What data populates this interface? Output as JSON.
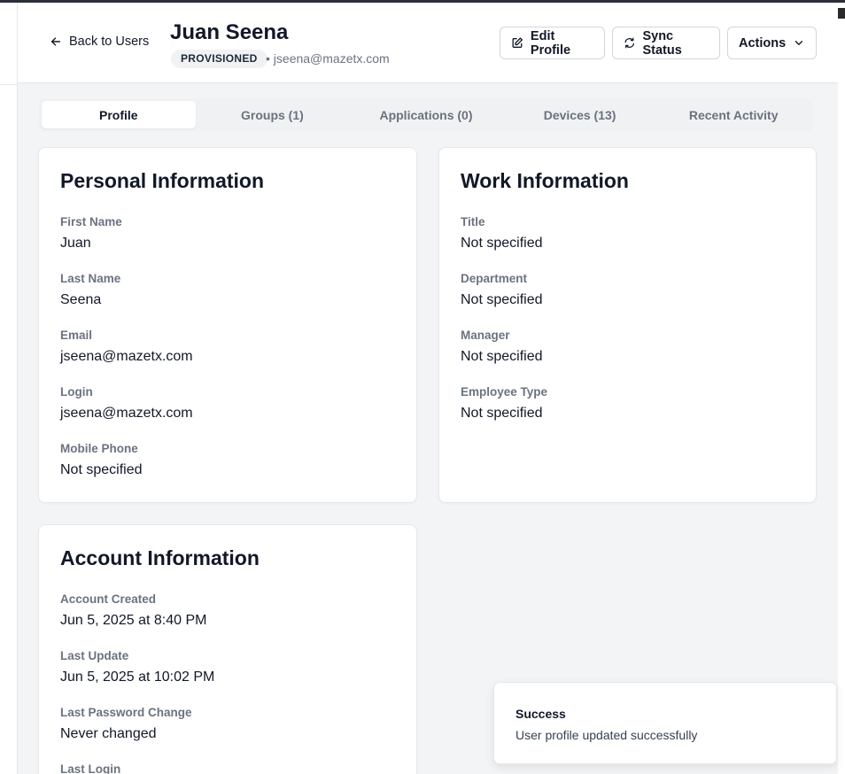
{
  "header": {
    "back_label": "Back to Users",
    "user_name": "Juan Seena",
    "status_badge": "PROVISIONED",
    "email": "• jseena@mazetx.com",
    "buttons": {
      "edit_profile": "Edit Profile",
      "sync_status": "Sync Status",
      "actions": "Actions"
    }
  },
  "tabs": [
    {
      "label": "Profile",
      "active": true
    },
    {
      "label": "Groups (1)",
      "active": false
    },
    {
      "label": "Applications (0)",
      "active": false
    },
    {
      "label": "Devices (13)",
      "active": false
    },
    {
      "label": "Recent Activity",
      "active": false
    }
  ],
  "personal": {
    "title": "Personal Information",
    "fields": [
      {
        "label": "First Name",
        "value": "Juan"
      },
      {
        "label": "Last Name",
        "value": "Seena"
      },
      {
        "label": "Email",
        "value": "jseena@mazetx.com"
      },
      {
        "label": "Login",
        "value": "jseena@mazetx.com"
      },
      {
        "label": "Mobile Phone",
        "value": "Not specified"
      }
    ]
  },
  "work": {
    "title": "Work Information",
    "fields": [
      {
        "label": "Title",
        "value": "Not specified"
      },
      {
        "label": "Department",
        "value": "Not specified"
      },
      {
        "label": "Manager",
        "value": "Not specified"
      },
      {
        "label": "Employee Type",
        "value": "Not specified"
      }
    ]
  },
  "account": {
    "title": "Account Information",
    "fields": [
      {
        "label": "Account Created",
        "value": "Jun 5, 2025 at 8:40 PM"
      },
      {
        "label": "Last Update",
        "value": "Jun 5, 2025 at 10:02 PM"
      },
      {
        "label": "Last Password Change",
        "value": "Never changed"
      },
      {
        "label": "Last Login",
        "value": ""
      }
    ]
  },
  "toast": {
    "title": "Success",
    "message": "User profile updated successfully"
  }
}
